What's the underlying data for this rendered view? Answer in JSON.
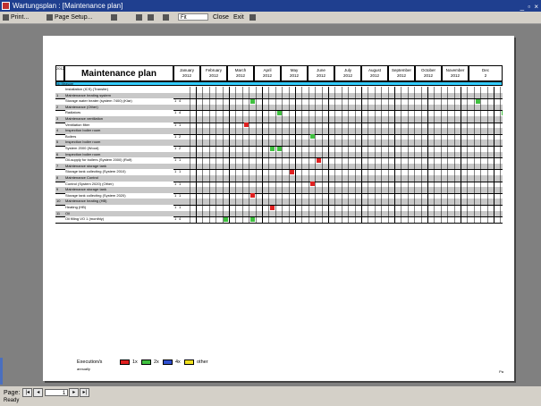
{
  "window": {
    "title": "Wartungsplan : [Maintenance plan]",
    "controls": "_ ▫ ×"
  },
  "toolbar": {
    "print_label": "Print...",
    "page_setup_label": "Page Setup...",
    "zoom_value": "Fit",
    "close_label": "Close",
    "exit_label": "Exit"
  },
  "report": {
    "corner_label": "2012",
    "title": "Maintenance plan",
    "months": [
      {
        "name": "January",
        "year": "2012"
      },
      {
        "name": "February",
        "year": "2012"
      },
      {
        "name": "March",
        "year": "2012"
      },
      {
        "name": "April",
        "year": "2012"
      },
      {
        "name": "May",
        "year": "2012"
      },
      {
        "name": "June",
        "year": "2012"
      },
      {
        "name": "July",
        "year": "2012"
      },
      {
        "name": "August",
        "year": "2012"
      },
      {
        "name": "September",
        "year": "2012"
      },
      {
        "name": "October",
        "year": "2012"
      },
      {
        "name": "November",
        "year": "2012"
      },
      {
        "name": "Dec",
        "year": "2"
      }
    ],
    "subheader": "No  Measure",
    "rows": [
      {
        "num": "",
        "label": "Installation (ICS) (Transfer)",
        "c1": "",
        "c2": "",
        "section": false,
        "marks": []
      },
      {
        "num": "1",
        "label": "Maintenance heating system",
        "c1": "",
        "c2": "",
        "section": true,
        "marks": []
      },
      {
        "num": "",
        "label": "Storage water heater (system 7400) (Klar)",
        "c1": "1",
        "c2": "4",
        "section": false,
        "marks": [
          {
            "col": 10,
            "color": "green"
          },
          {
            "col": 44,
            "color": "green"
          }
        ]
      },
      {
        "num": "2",
        "label": "Maintenance (Other)",
        "c1": "",
        "c2": "",
        "section": true,
        "marks": []
      },
      {
        "num": "",
        "label": "Radiators",
        "c1": "1",
        "c2": "4",
        "section": false,
        "marks": [
          {
            "col": 14,
            "color": "green"
          },
          {
            "col": 48,
            "color": "green"
          }
        ]
      },
      {
        "num": "3",
        "label": "Maintenance ventilation",
        "c1": "",
        "c2": "",
        "section": true,
        "marks": []
      },
      {
        "num": "",
        "label": "Ventilation filter",
        "c1": "1",
        "c2": "1",
        "section": false,
        "marks": [
          {
            "col": 9,
            "color": "red"
          }
        ]
      },
      {
        "num": "4",
        "label": "Inspection boiler room",
        "c1": "",
        "c2": "",
        "section": true,
        "marks": []
      },
      {
        "num": "",
        "label": "Boilers",
        "c1": "1",
        "c2": "2",
        "section": false,
        "marks": [
          {
            "col": 19,
            "color": "green"
          },
          {
            "col": 53,
            "color": "green"
          }
        ]
      },
      {
        "num": "5",
        "label": "Inspection boiler room",
        "c1": "",
        "c2": "",
        "section": true,
        "marks": []
      },
      {
        "num": "",
        "label": "System 2000 (Wood)",
        "c1": "1",
        "c2": "2",
        "section": false,
        "marks": [
          {
            "col": 13,
            "color": "green"
          },
          {
            "col": 14,
            "color": "green"
          }
        ]
      },
      {
        "num": "6",
        "label": "Inspection boiler room",
        "c1": "",
        "c2": "",
        "section": true,
        "marks": []
      },
      {
        "num": "",
        "label": "Oil-supply for boilers (System 2000) (Rolf)",
        "c1": "1",
        "c2": "1",
        "section": false,
        "marks": [
          {
            "col": 20,
            "color": "red"
          }
        ]
      },
      {
        "num": "7",
        "label": "Maintenance storage tank",
        "c1": "",
        "c2": "",
        "section": true,
        "marks": []
      },
      {
        "num": "",
        "label": "Storage tank collecting (System 2010)",
        "c1": "1",
        "c2": "1",
        "section": false,
        "marks": [
          {
            "col": 16,
            "color": "red"
          }
        ]
      },
      {
        "num": "8",
        "label": "Maintenance Control",
        "c1": "",
        "c2": "",
        "section": true,
        "marks": []
      },
      {
        "num": "",
        "label": "Control (System 2020) (Other)",
        "c1": "1",
        "c2": "1",
        "section": false,
        "marks": [
          {
            "col": 19,
            "color": "red"
          }
        ]
      },
      {
        "num": "9",
        "label": "Maintenance storage tank",
        "c1": "",
        "c2": "",
        "section": true,
        "marks": []
      },
      {
        "num": "",
        "label": "Storage tank collecting (System 2020)",
        "c1": "1",
        "c2": "1",
        "section": false,
        "marks": [
          {
            "col": 10,
            "color": "red"
          }
        ]
      },
      {
        "num": "10",
        "label": "Maintenance heating (HB)",
        "c1": "",
        "c2": "",
        "section": true,
        "marks": []
      },
      {
        "num": "",
        "label": "Heating (HB)",
        "c1": "1",
        "c2": "1",
        "section": false,
        "marks": [
          {
            "col": 13,
            "color": "red"
          }
        ]
      },
      {
        "num": "11",
        "label": "Oil",
        "c1": "",
        "c2": "",
        "section": true,
        "marks": []
      },
      {
        "num": "",
        "label": "Oil filling VO 1 (monthly)",
        "c1": "1",
        "c2": "4",
        "section": false,
        "marks": [
          {
            "col": 6,
            "color": "green"
          },
          {
            "col": 10,
            "color": "green"
          }
        ]
      }
    ],
    "legend": {
      "label": "Execution/s",
      "sub": "annually",
      "items": [
        {
          "label": "1x",
          "color": "#e02020"
        },
        {
          "label": "2x",
          "color": "#40c040"
        },
        {
          "label": "4x",
          "color": "#3050d0"
        },
        {
          "label": "other",
          "color": "#f0e020"
        }
      ]
    },
    "page_footer": "Pa"
  },
  "nav": {
    "page_label": "Page:",
    "page_value": "1"
  },
  "status": {
    "text": "Ready"
  },
  "colors": {
    "red": "#e02020",
    "green": "#40c040",
    "blue": "#3050d0",
    "yellow": "#f0e020",
    "header_blue": "#33ccff"
  }
}
